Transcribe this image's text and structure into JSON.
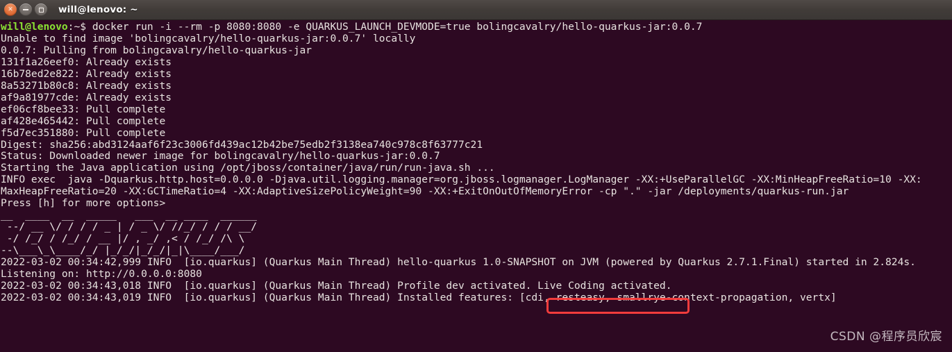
{
  "window": {
    "title": "will@lenovo: ~",
    "buttons": {
      "close": "close-button",
      "minimize": "minimize-button",
      "maximize": "maximize-button"
    },
    "colors": {
      "terminal_background": "#2d0922",
      "titlebar_background": "#413c39",
      "prompt_green": "#8ae234",
      "text_white": "#e8e3e0",
      "annotation_red": "#f23c3c"
    }
  },
  "terminal": {
    "prompt": {
      "user_host": "will@lenovo",
      "path": ":~$ "
    },
    "command": "docker run -i --rm -p 8080:8080 -e QUARKUS_LAUNCH_DEVMODE=true bolingcavalry/hello-quarkus-jar:0.0.7",
    "output_lines": [
      "Unable to find image 'bolingcavalry/hello-quarkus-jar:0.0.7' locally",
      "0.0.7: Pulling from bolingcavalry/hello-quarkus-jar",
      "131f1a26eef0: Already exists",
      "16b78ed2e822: Already exists",
      "8a53271b80c8: Already exists",
      "af9a81977cde: Already exists",
      "ef06cf8bee33: Pull complete",
      "af428e465442: Pull complete",
      "f5d7ec351880: Pull complete",
      "Digest: sha256:abd3124aaf6f23c3006fd439ac12b42be75edb2f3138ea740c978c8f63777c21",
      "Status: Downloaded newer image for bolingcavalry/hello-quarkus-jar:0.0.7",
      "Starting the Java application using /opt/jboss/container/java/run/run-java.sh ...",
      "INFO exec  java -Dquarkus.http.host=0.0.0.0 -Djava.util.logging.manager=org.jboss.logmanager.LogManager -XX:+UseParallelGC -XX:MinHeapFreeRatio=10 -XX:",
      "MaxHeapFreeRatio=20 -XX:GCTimeRatio=4 -XX:AdaptiveSizePolicyWeight=90 -XX:+ExitOnOutOfMemoryError -cp \".\" -jar /deployments/quarkus-run.jar",
      "Press [h] for more options>"
    ],
    "ascii_art": [
      "__  ____  __  _____   ___  __ ____  ______ ",
      " --/ __ \\/ / / / _ | / _ \\/ //_/ / / / __/ ",
      " -/ /_/ / /_/ / __ |/ , _/ ,< / /_/ /\\ \\   ",
      "--\\___\\_\\____/_/ |_/_/|_/_/|_|\\____/___/   "
    ],
    "log_lines": [
      "2022-03-02 00:34:42,999 INFO  [io.quarkus] (Quarkus Main Thread) hello-quarkus 1.0-SNAPSHOT on JVM (powered by Quarkus 2.7.1.Final) started in 2.824s.",
      "Listening on: http://0.0.0.0:8080",
      "2022-03-02 00:34:43,018 INFO  [io.quarkus] (Quarkus Main Thread) Profile dev activated. Live Coding activated.",
      "2022-03-02 00:34:43,019 INFO  [io.quarkus] (Quarkus Main Thread) Installed features: [cdi, resteasy, smallrye-context-propagation, vertx]"
    ],
    "highlighted_text": "Live Coding activated."
  },
  "watermark": {
    "text": "CSDN @程序员欣宸"
  }
}
